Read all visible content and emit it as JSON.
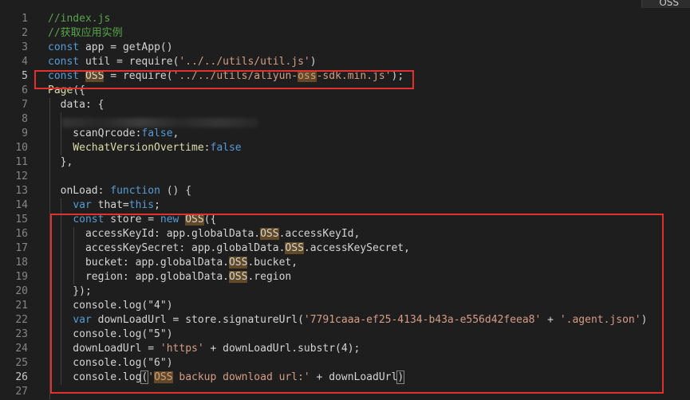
{
  "editor": {
    "corner_tab": "OSS",
    "lines": [
      {
        "n": "1",
        "tokens": [
          {
            "t": "//index.js",
            "c": "tk-comment"
          }
        ]
      },
      {
        "n": "2",
        "tokens": [
          {
            "t": "//获取应用实例",
            "c": "tk-comment"
          }
        ]
      },
      {
        "n": "3",
        "tokens": [
          {
            "t": "const",
            "c": "tk-kw"
          },
          {
            "t": " app = ",
            "c": "tk-plain"
          },
          {
            "t": "getApp",
            "c": "tk-plain"
          },
          {
            "t": "()",
            "c": "tk-plain"
          }
        ]
      },
      {
        "n": "4",
        "tokens": [
          {
            "t": "const",
            "c": "tk-kw"
          },
          {
            "t": " util = ",
            "c": "tk-plain"
          },
          {
            "t": "require",
            "c": "tk-plain"
          },
          {
            "t": "(",
            "c": "tk-plain"
          },
          {
            "t": "'../../utils/util.js'",
            "c": "tk-str"
          },
          {
            "t": ")",
            "c": "tk-plain"
          }
        ]
      },
      {
        "n": "5",
        "tokens": [
          {
            "t": "const",
            "c": "tk-kw"
          },
          {
            "t": " ",
            "c": "tk-plain"
          },
          {
            "t": "OSS",
            "c": "tk-plain tk-hl"
          },
          {
            "t": " = ",
            "c": "tk-plain"
          },
          {
            "t": "require",
            "c": "tk-plain"
          },
          {
            "t": "(",
            "c": "tk-plain"
          },
          {
            "t": "'../../utils/aliyun-",
            "c": "tk-str"
          },
          {
            "t": "oss",
            "c": "tk-str tk-hl"
          },
          {
            "t": "-sdk.min.js'",
            "c": "tk-str"
          },
          {
            "t": ");",
            "c": "tk-plain"
          }
        ]
      },
      {
        "n": "6",
        "tokens": [
          {
            "t": "Page",
            "c": "tk-fn"
          },
          {
            "t": "({",
            "c": "tk-plain"
          }
        ]
      },
      {
        "n": "7",
        "tokens": [
          {
            "t": "  data",
            "c": "tk-plain"
          },
          {
            "t": ": {",
            "c": "tk-plain"
          }
        ]
      },
      {
        "n": "8",
        "tokens": []
      },
      {
        "n": "9",
        "tokens": [
          {
            "t": "    scanQrcode",
            "c": "tk-plain"
          },
          {
            "t": ":",
            "c": "tk-plain"
          },
          {
            "t": "false",
            "c": "tk-bool"
          },
          {
            "t": ",",
            "c": "tk-plain"
          }
        ]
      },
      {
        "n": "10",
        "tokens": [
          {
            "t": "    WechatVersionOvertime",
            "c": "tk-fn"
          },
          {
            "t": ":",
            "c": "tk-plain"
          },
          {
            "t": "false",
            "c": "tk-bool"
          }
        ]
      },
      {
        "n": "11",
        "tokens": [
          {
            "t": "  },",
            "c": "tk-plain"
          }
        ]
      },
      {
        "n": "12",
        "tokens": []
      },
      {
        "n": "13",
        "tokens": [
          {
            "t": "  onLoad",
            "c": "tk-plain"
          },
          {
            "t": ": ",
            "c": "tk-plain"
          },
          {
            "t": "function",
            "c": "tk-kw"
          },
          {
            "t": " () {",
            "c": "tk-plain"
          }
        ]
      },
      {
        "n": "14",
        "tokens": [
          {
            "t": "    ",
            "c": "tk-plain"
          },
          {
            "t": "var",
            "c": "tk-kw"
          },
          {
            "t": " that=",
            "c": "tk-plain"
          },
          {
            "t": "this",
            "c": "tk-kw"
          },
          {
            "t": ";",
            "c": "tk-plain"
          }
        ]
      },
      {
        "n": "15",
        "tokens": [
          {
            "t": "    ",
            "c": "tk-plain"
          },
          {
            "t": "const",
            "c": "tk-kw"
          },
          {
            "t": " store = ",
            "c": "tk-plain"
          },
          {
            "t": "new",
            "c": "tk-kw"
          },
          {
            "t": " ",
            "c": "tk-plain"
          },
          {
            "t": "OSS",
            "c": "tk-plain tk-hl"
          },
          {
            "t": "({",
            "c": "tk-plain"
          }
        ]
      },
      {
        "n": "16",
        "tokens": [
          {
            "t": "      accessKeyId: app.globalData.",
            "c": "tk-plain"
          },
          {
            "t": "OSS",
            "c": "tk-plain tk-hl"
          },
          {
            "t": ".accessKeyId,",
            "c": "tk-plain"
          }
        ]
      },
      {
        "n": "17",
        "tokens": [
          {
            "t": "      accessKeySecret: app.globalData.",
            "c": "tk-plain"
          },
          {
            "t": "OSS",
            "c": "tk-plain tk-hl"
          },
          {
            "t": ".accessKeySecret,",
            "c": "tk-plain"
          }
        ]
      },
      {
        "n": "18",
        "tokens": [
          {
            "t": "      bucket: app.globalData.",
            "c": "tk-plain"
          },
          {
            "t": "OSS",
            "c": "tk-plain tk-hl"
          },
          {
            "t": ".bucket,",
            "c": "tk-plain"
          }
        ]
      },
      {
        "n": "19",
        "tokens": [
          {
            "t": "      region: app.globalData.",
            "c": "tk-plain"
          },
          {
            "t": "OSS",
            "c": "tk-plain tk-hl"
          },
          {
            "t": ".region",
            "c": "tk-plain"
          }
        ]
      },
      {
        "n": "20",
        "tokens": [
          {
            "t": "    });",
            "c": "tk-plain"
          }
        ]
      },
      {
        "n": "21",
        "tokens": [
          {
            "t": "    console.log(\"4\")",
            "c": "tk-plain"
          }
        ]
      },
      {
        "n": "22",
        "tokens": [
          {
            "t": "    ",
            "c": "tk-plain"
          },
          {
            "t": "var",
            "c": "tk-kw"
          },
          {
            "t": " downLoadUrl = store.signatureUrl(",
            "c": "tk-plain"
          },
          {
            "t": "'7791caaa-ef25-4134-b43a-e556d42feea8'",
            "c": "tk-str"
          },
          {
            "t": " + ",
            "c": "tk-plain"
          },
          {
            "t": "'.agent.json'",
            "c": "tk-str"
          },
          {
            "t": ")",
            "c": "tk-plain"
          }
        ]
      },
      {
        "n": "23",
        "tokens": [
          {
            "t": "    console.log(\"5\")",
            "c": "tk-plain"
          }
        ]
      },
      {
        "n": "24",
        "tokens": [
          {
            "t": "    downLoadUrl = ",
            "c": "tk-plain"
          },
          {
            "t": "'https'",
            "c": "tk-str"
          },
          {
            "t": " + downLoadUrl.substr(4);",
            "c": "tk-plain"
          }
        ]
      },
      {
        "n": "25",
        "tokens": [
          {
            "t": "    console.log(\"6\")",
            "c": "tk-plain"
          }
        ]
      },
      {
        "n": "26",
        "tokens": [
          {
            "t": "    console.log",
            "c": "tk-plain"
          },
          {
            "t": "(",
            "c": "tk-plain tk-bracket"
          },
          {
            "t": "'",
            "c": "tk-str"
          },
          {
            "t": "OSS",
            "c": "tk-str tk-hl"
          },
          {
            "t": " backup download url:'",
            "c": "tk-str"
          },
          {
            "t": " + downLoadUrl",
            "c": "tk-plain"
          },
          {
            "t": ")",
            "c": "tk-plain tk-bracket"
          }
        ]
      },
      {
        "n": "27",
        "tokens": []
      }
    ]
  }
}
